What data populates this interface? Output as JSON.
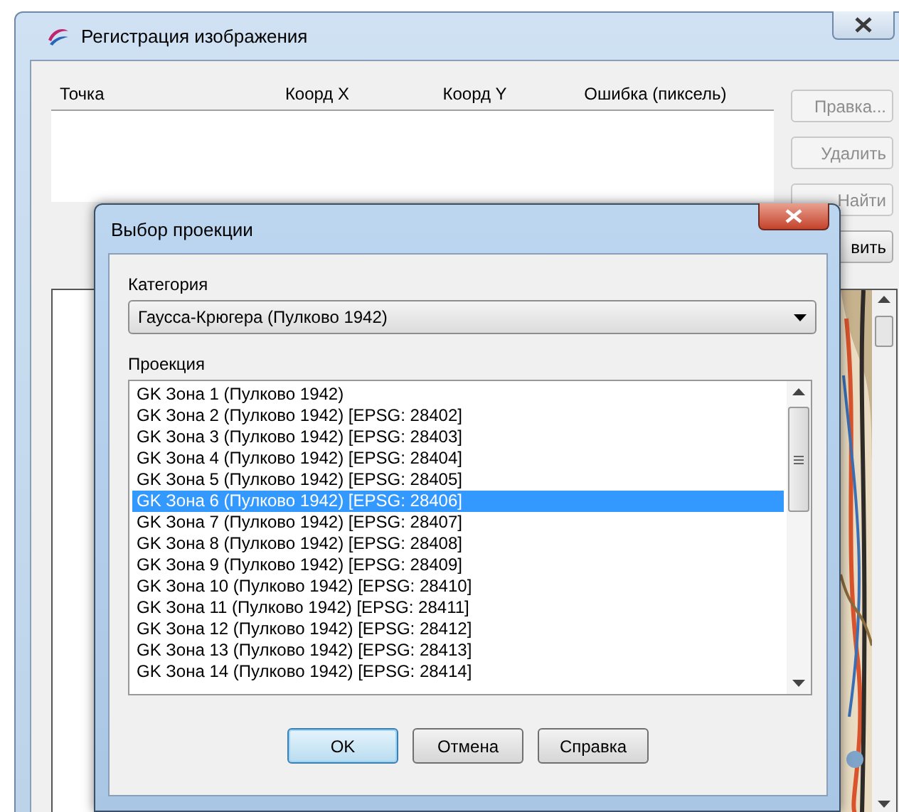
{
  "main_window": {
    "title": "Регистрация изображения",
    "points_table": {
      "columns": [
        "Точка",
        "Коорд X",
        "Коорд Y",
        "Ошибка (пиксель)"
      ]
    },
    "buttons": [
      {
        "label": "Правка...",
        "disabled": true
      },
      {
        "label": "Удалить",
        "disabled": true
      },
      {
        "label": "Найти",
        "disabled": true
      },
      {
        "label": "вить",
        "disabled": false
      }
    ]
  },
  "dialog": {
    "title": "Выбор проекции",
    "category_label": "Категория",
    "category": "Гаусса-Крюгера (Пулково 1942)",
    "projection_label": "Проекция",
    "projections": [
      {
        "label": "GK Зона 1 (Пулково 1942)",
        "selected": false
      },
      {
        "label": "GK Зона 2 (Пулково 1942) [EPSG: 28402]",
        "selected": false
      },
      {
        "label": "GK Зона 3 (Пулково 1942) [EPSG: 28403]",
        "selected": false
      },
      {
        "label": "GK Зона 4 (Пулково 1942) [EPSG: 28404]",
        "selected": false
      },
      {
        "label": "GK Зона 5 (Пулково 1942) [EPSG: 28405]",
        "selected": false
      },
      {
        "label": "GK Зона 6 (Пулково 1942) [EPSG: 28406]",
        "selected": true
      },
      {
        "label": "GK Зона 7 (Пулково 1942) [EPSG: 28407]",
        "selected": false
      },
      {
        "label": "GK Зона 8 (Пулково 1942) [EPSG: 28408]",
        "selected": false
      },
      {
        "label": "GK Зона 9 (Пулково 1942) [EPSG: 28409]",
        "selected": false
      },
      {
        "label": "GK Зона 10 (Пулково 1942) [EPSG: 28410]",
        "selected": false
      },
      {
        "label": "GK Зона 11 (Пулково 1942) [EPSG: 28411]",
        "selected": false
      },
      {
        "label": "GK Зона 12 (Пулково 1942) [EPSG: 28412]",
        "selected": false
      },
      {
        "label": "GK Зона 13 (Пулково 1942) [EPSG: 28413]",
        "selected": false
      },
      {
        "label": "GK Зона 14 (Пулково 1942) [EPSG: 28414]",
        "selected": false
      }
    ],
    "buttons": [
      {
        "label": "OK",
        "default": true
      },
      {
        "label": "Отмена",
        "default": false
      },
      {
        "label": "Справка",
        "default": false
      }
    ]
  }
}
